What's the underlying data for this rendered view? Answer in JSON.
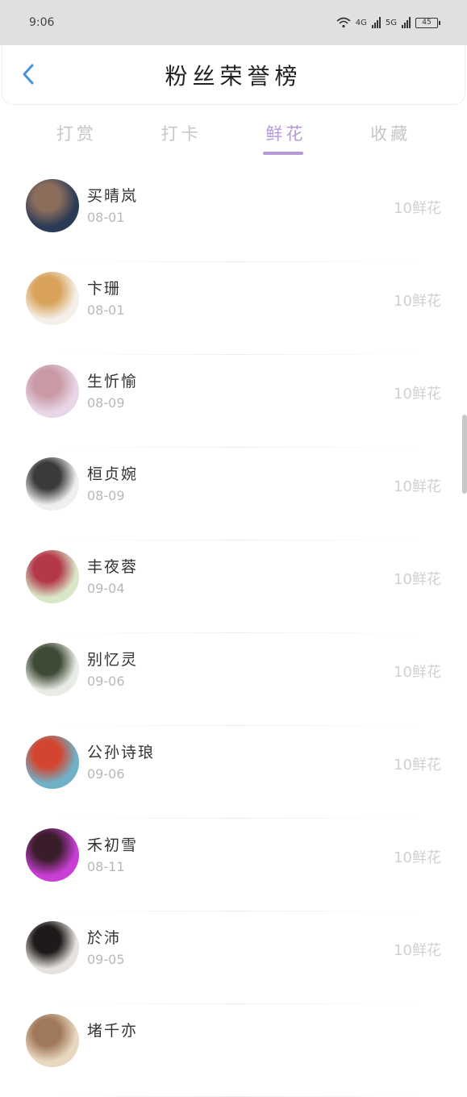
{
  "status_bar": {
    "time": "9:06",
    "network_1": "4G",
    "network_2": "5G",
    "battery": "45"
  },
  "header": {
    "title": "粉丝荣誉榜"
  },
  "tabs": [
    {
      "label": "打赏",
      "active": false
    },
    {
      "label": "打卡",
      "active": false
    },
    {
      "label": "鲜花",
      "active": true
    },
    {
      "label": "收藏",
      "active": false
    }
  ],
  "colors": {
    "accent": "#b399d8",
    "back_icon": "#4a90e2",
    "status_bar_bg": "#e0e0e0"
  },
  "fans": [
    {
      "name": "买晴岚",
      "date": "08-01",
      "count": "10鲜花",
      "avatar_colors": [
        "#2b3a55",
        "#8b6d5c"
      ]
    },
    {
      "name": "卞珊",
      "date": "08-01",
      "count": "10鲜花",
      "avatar_colors": [
        "#f4efe8",
        "#d8a25a"
      ]
    },
    {
      "name": "生忻愉",
      "date": "08-09",
      "count": "10鲜花",
      "avatar_colors": [
        "#e8d6e8",
        "#c99aa6"
      ]
    },
    {
      "name": "桓贞婉",
      "date": "08-09",
      "count": "10鲜花",
      "avatar_colors": [
        "#efefef",
        "#3a3a3a"
      ]
    },
    {
      "name": "丰夜蓉",
      "date": "09-04",
      "count": "10鲜花",
      "avatar_colors": [
        "#d9e7c8",
        "#b3384a"
      ]
    },
    {
      "name": "别忆灵",
      "date": "09-06",
      "count": "10鲜花",
      "avatar_colors": [
        "#e9ece6",
        "#3d4a34"
      ]
    },
    {
      "name": "公孙诗琅",
      "date": "09-06",
      "count": "10鲜花",
      "avatar_colors": [
        "#6fb2c8",
        "#d4452f"
      ]
    },
    {
      "name": "禾初雪",
      "date": "08-11",
      "count": "10鲜花",
      "avatar_colors": [
        "#c93fd6",
        "#3a1d2b"
      ]
    },
    {
      "name": "於沛",
      "date": "09-05",
      "count": "10鲜花",
      "avatar_colors": [
        "#e6e2de",
        "#1e1a1a"
      ]
    },
    {
      "name": "堵千亦",
      "date": "",
      "count": "",
      "avatar_colors": [
        "#e9d8c0",
        "#a0785a"
      ]
    }
  ]
}
